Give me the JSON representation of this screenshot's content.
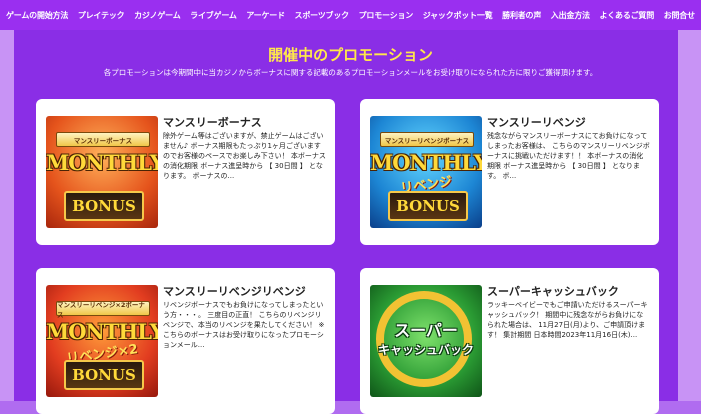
{
  "nav": {
    "items": [
      "ゲームの開始方法",
      "プレイテック",
      "カジノゲーム",
      "ライブゲーム",
      "アーケード",
      "スポーツブック",
      "プロモーション",
      "ジャックポット一覧",
      "勝利者の声",
      "入出金方法",
      "よくあるご質問",
      "お問合せ"
    ]
  },
  "header": {
    "title": "開催中のプロモーション",
    "subtitle": "各プロモーションは今期間中に当カジノからボーナスに関する記載のあるプロモーションメールをお受け取りになられた方に限りご獲得頂けます。"
  },
  "promos": [
    {
      "title": "マンスリーボーナス",
      "description": "除外ゲーム等はございますが、禁止ゲームはございません♪ ボーナス期限もたっぷり1ヶ月ございますのでお客様のペースでお楽しみ下さい！ 本ボーナスの消化期限 ボーナス進呈時から 【 30日間 】 となります。 ボーナスの...",
      "image": {
        "banner": "マンスリーボーナス",
        "main": "MONTHLY",
        "overlay": "",
        "sub": "BONUS"
      }
    },
    {
      "title": "マンスリーリベンジ",
      "description": "残念ながらマンスリーボーナスにてお負けになってしまったお客様は、 こちらのマンスリーリベンジボーナスに挑戦いただけます！！ 本ボーナスの消化期限 ボーナス進呈時から 【 30日間 】 となります。 ボ...",
      "image": {
        "banner": "マンスリーリベンジボーナス",
        "main": "MONTHLY",
        "overlay": "リベンジ",
        "sub": "BONUS"
      }
    },
    {
      "title": "マンスリーリベンジリベンジ",
      "description": "リベンジボーナスでもお負けになってしまったという方・・・。 三度目の正直！ こちらのリベンジリベンジで、本当のリベンジを果たしてください！ ※こちらのボーナスはお受け取りになったプロモーションメール...",
      "image": {
        "banner": "マンスリーリベンジ×2ボーナス",
        "main": "MONTHLY",
        "overlay": "リベンジ×2",
        "sub": "BONUS"
      }
    },
    {
      "title": "スーパーキャッシュバック",
      "description": "ラッキーベイビーでもご申請いただけるスーパーキャッシュバック！ 期間中に残念ながらお負けになられた場合は、 11月27日(月)より、ご申請頂けます！ 集計期間 日本時間2023年11月16日(木)...",
      "image": {
        "line1": "スーパー",
        "line2": "キャッシュバック"
      }
    }
  ]
}
